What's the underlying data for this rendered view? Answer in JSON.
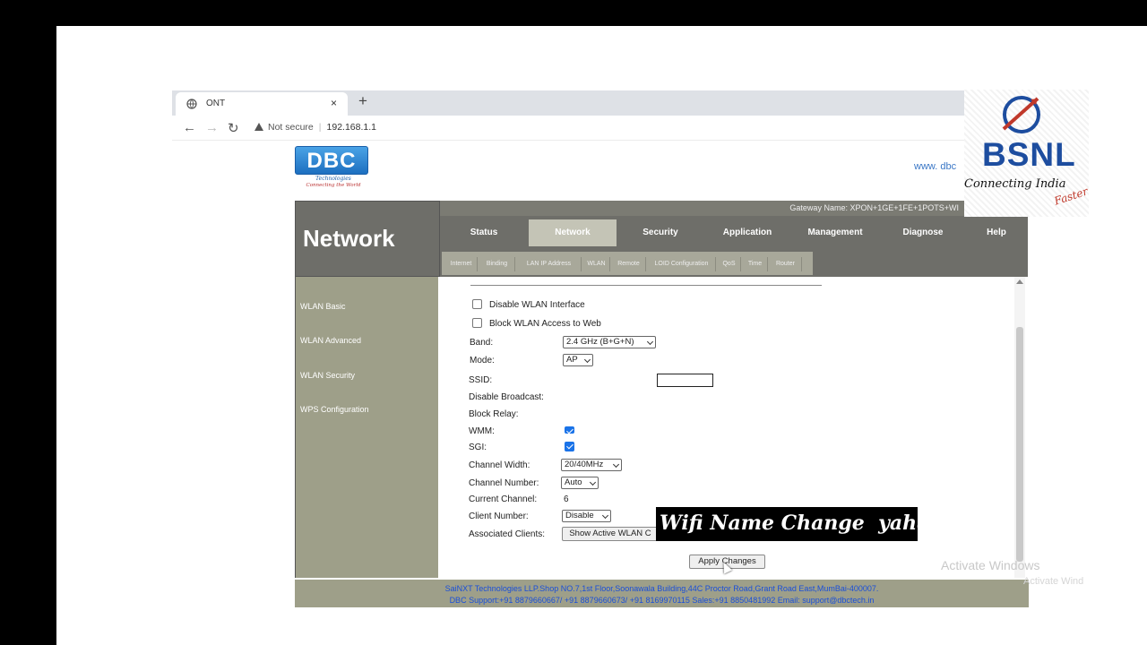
{
  "browser": {
    "tab_title": "ONT",
    "tab_close": "×",
    "new_tab": "+",
    "security_label": "Not secure",
    "url": "192.168.1.1"
  },
  "brand": {
    "dbc_logo": "DBC",
    "dbc_subtitle": "Technologies",
    "dbc_tagline": "Connecting the World",
    "website": "www. dbc"
  },
  "header": {
    "section_title": "Network",
    "gateway": "Gateway Name: XPON+1GE+1FE+1POTS+WI"
  },
  "nav": {
    "tabs": [
      "Status",
      "Network",
      "Security",
      "Application",
      "Management",
      "Diagnose",
      "Help"
    ],
    "active": "Network"
  },
  "subnav": {
    "tabs": [
      "Internet",
      "Binding",
      "LAN IP Address",
      "WLAN",
      "Remote",
      "LOID Configuration",
      "QoS",
      "Time",
      "Router"
    ]
  },
  "sidebar": {
    "items": [
      "WLAN Basic",
      "WLAN Advanced",
      "WLAN Security",
      "WPS Configuration"
    ]
  },
  "form": {
    "disable_wlan": "Disable WLAN Interface",
    "block_wlan": "Block WLAN Access to Web",
    "band_label": "Band:",
    "band_value": "2.4 GHz (B+G+N)",
    "mode_label": "Mode:",
    "mode_value": "AP",
    "ssid_label": "SSID:",
    "disable_broadcast_label": "Disable Broadcast:",
    "block_relay_label": "Block Relay:",
    "wmm_label": "WMM:",
    "sgi_label": "SGI:",
    "channel_width_label": "Channel Width:",
    "channel_width_value": "20/40MHz",
    "channel_number_label": "Channel Number:",
    "channel_number_value": "Auto",
    "current_channel_label": "Current Channel:",
    "current_channel_value": "6",
    "client_number_label": "Client Number:",
    "client_number_value": "Disable",
    "associated_clients_label": "Associated Clients:",
    "show_clients_button": "Show Active WLAN C",
    "apply_button": "Apply Changes"
  },
  "footer": {
    "line1": "SaiNXT Technologies LLP.Shop NO.7,1st Floor,Soonawala Building,44C Proctor Road,Grant Road East,MumBai-400007.",
    "line2": "DBC Support:+91 8879660667/ +91 8879660673/ +91 8169970115 Sales:+91 8850481992 Email: support@dbctech.in"
  },
  "overlay": {
    "banner_text": "Wifi Name Change  yaha",
    "bsnl_name": "BSNL",
    "bsnl_tagline": "Connecting India",
    "bsnl_tagline2": "Faster",
    "activate_windows": "Activate Windows",
    "activate_windows_sub": "Activate Wind"
  },
  "colors": {
    "header_gray": "#6e6e69",
    "sidebar_olive": "#9e9f89",
    "active_tab": "#c4c4b6",
    "banner_bg": "#000000",
    "bsnl_blue": "#1d4d9f"
  }
}
